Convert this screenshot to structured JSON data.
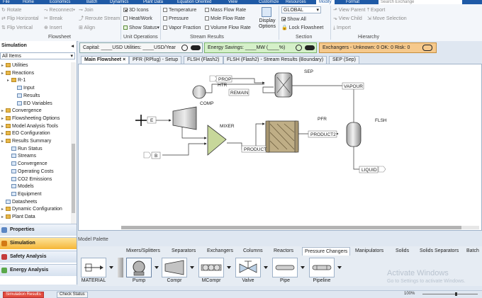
{
  "menubar": {
    "tabs": [
      "File",
      "Home",
      "Economics",
      "Batch",
      "Dynamics",
      "Plant Data",
      "Equation Oriented",
      "View",
      "Customize",
      "Resources",
      "Modify",
      "Format"
    ],
    "active_tab": "Modify",
    "search_placeholder": "Search Exchange"
  },
  "ribbon": {
    "flowsheet": {
      "items": [
        "Rotate",
        "Flip Horizontal",
        "Flip Vertical",
        "Reconnect",
        "Break",
        "Insert",
        "Join",
        "Reroute Stream",
        "Align"
      ],
      "label": "Flowsheet"
    },
    "unit_operations": {
      "items": [
        "3D Icons",
        "Heat/Work",
        "Show Status"
      ],
      "checked": [
        true,
        false,
        false
      ],
      "label": "Unit Operations"
    },
    "stream_results": {
      "col1": [
        "Temperature",
        "Pressure",
        "Vapor Fraction"
      ],
      "col2": [
        "Mass Flow Rate",
        "Mole Flow Rate",
        "Volume Flow Rate"
      ],
      "display_options": "Display Options",
      "label": "Stream Results"
    },
    "section": {
      "dropdown": "GLOBAL",
      "show_all": "Show All",
      "lock": "Lock Flowsheet",
      "label": "Section"
    },
    "hierarchy": {
      "items": [
        "View Parent",
        "View Child",
        "Import",
        "Export",
        "Move Selection"
      ],
      "label": "Hierarchy"
    }
  },
  "status": {
    "capital": "Capital: ____USD  Utilities: ____USD/Year",
    "energy": "Energy Savings: ____MW  (____%)",
    "exchangers": "Exchangers - Unknown: 0  OK: 0  Risk: 0"
  },
  "left_panel": {
    "title": "Simulation",
    "filter": "All Items",
    "tree": [
      {
        "label": "Utilities",
        "level": 1,
        "icon": "folder"
      },
      {
        "label": "Reactions",
        "level": 1,
        "icon": "folder"
      },
      {
        "label": "R-1",
        "level": 2,
        "icon": "folder"
      },
      {
        "label": "Input",
        "level": 3,
        "icon": "page"
      },
      {
        "label": "Results",
        "level": 3,
        "icon": "page"
      },
      {
        "label": "EO Variables",
        "level": 3,
        "icon": "page"
      },
      {
        "label": "Convergence",
        "level": 1,
        "icon": "folder"
      },
      {
        "label": "Flowsheeting Options",
        "level": 1,
        "icon": "folder"
      },
      {
        "label": "Model Analysis Tools",
        "level": 1,
        "icon": "folder"
      },
      {
        "label": "EO Configuration",
        "level": 1,
        "icon": "folder"
      },
      {
        "label": "Results Summary",
        "level": 1,
        "icon": "folder"
      },
      {
        "label": "Run Status",
        "level": 2,
        "icon": "page"
      },
      {
        "label": "Streams",
        "level": 2,
        "icon": "page"
      },
      {
        "label": "Convergence",
        "level": 2,
        "icon": "page"
      },
      {
        "label": "Operating Costs",
        "level": 2,
        "icon": "page"
      },
      {
        "label": "CO2 Emissions",
        "level": 2,
        "icon": "page"
      },
      {
        "label": "Models",
        "level": 2,
        "icon": "page"
      },
      {
        "label": "Equipment",
        "level": 2,
        "icon": "page"
      },
      {
        "label": "Datasheets",
        "level": 1,
        "icon": "page"
      },
      {
        "label": "Dynamic Configuration",
        "level": 1,
        "icon": "folder"
      },
      {
        "label": "Plant Data",
        "level": 1,
        "icon": "folder"
      }
    ],
    "nav": [
      "Properties",
      "Simulation",
      "Safety Analysis",
      "Energy Analysis"
    ],
    "nav_active": "Simulation"
  },
  "doc_tabs": [
    "Main Flowsheet",
    "PFR (RPlug) - Setup",
    "FLSH (Flash2)",
    "FLSH (Flash2) - Stream Results (Boundary)",
    "SEP (Sep)"
  ],
  "doc_tabs_active": "Main Flowsheet",
  "flowsheet": {
    "blocks": {
      "sep": "SEP",
      "comp": "COMP",
      "mixer": "MIXER",
      "pfr": "PFR",
      "flsh": "FLSH"
    },
    "streams": {
      "prop": "PROP",
      "htr": "HTR",
      "remain": "REMAIN",
      "vapour": "VAPOUR",
      "e": "E",
      "b": "B",
      "product": "PRODUCT",
      "product2": "PRODUCT2",
      "liquid": "LIQUID"
    }
  },
  "palette": {
    "title": "Model Palette",
    "tabs": [
      "Mixers/Splitters",
      "Separators",
      "Exchangers",
      "Columns",
      "Reactors",
      "Pressure Changers",
      "Manipulators",
      "Solids",
      "Solids Separators",
      "Batch"
    ],
    "active_tab": "Pressure Changers",
    "items": [
      "MATERIAL",
      "Pump",
      "Compr",
      "MCompr",
      "Valve",
      "Pipe",
      "Pipeline"
    ]
  },
  "watermark": {
    "title": "Activate Windows",
    "subtitle": "Go to Settings to activate Windows."
  },
  "bottom": {
    "results": "Simulation Results",
    "check": "Check Status",
    "zoom": "100%"
  }
}
